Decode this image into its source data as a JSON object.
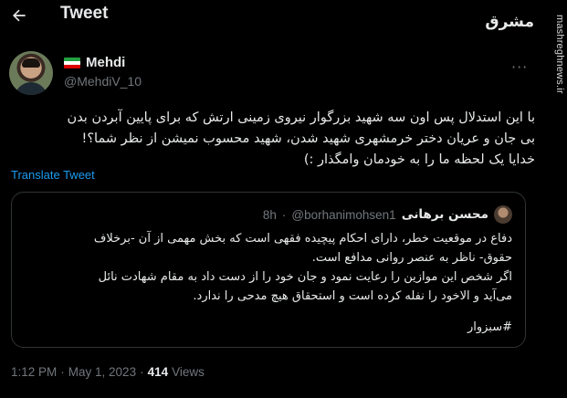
{
  "header": {
    "title": "Tweet",
    "back_icon": "arrow-left-icon"
  },
  "watermark": {
    "logo_text": "مشرق",
    "site": "mashreghnews.ir"
  },
  "author": {
    "display_name": "Mehdi",
    "handle": "@MehdiV_10",
    "flag_colors": [
      "#239f40",
      "#ffffff",
      "#da0000"
    ]
  },
  "tweet": {
    "lines": [
      "با این استدلال پس اون سه شهید بزرگوار نیروی زمینی ارتش که برای پایین آبردن بدن",
      "بی جان و عریان دختر خرمشهری شهید شدن، شهید محسوب نمیشن از نظر شما؟!",
      "خدایا یک لحظه ما را به خودمان وامگذار :)"
    ],
    "translate_label": "Translate Tweet"
  },
  "quoted": {
    "name": "محسن برهانی",
    "handle": "@borhanimohsen1",
    "separator": "·",
    "time": "8h",
    "lines": [
      "دفاع در موقعیت خطر، دارای احکام پیچیده فقهی است که بخش مهمی از آن -برخلاف",
      "حقوق- ناظر به عنصر روانی مدافع است.",
      "اگر شخص این موازین را رعایت نمود و جان خود را از دست داد به مقام شهادت نائل",
      "می‌آید و الا‌خود را نفله کرده است و استحقاق هیچ مدحی را ندارد."
    ],
    "hashtag": "#سبزوار"
  },
  "footer": {
    "time": "1:12 PM",
    "dot1": "·",
    "date": "May 1, 2023",
    "dot2": "·",
    "views_count": "414",
    "views_label": "Views"
  }
}
